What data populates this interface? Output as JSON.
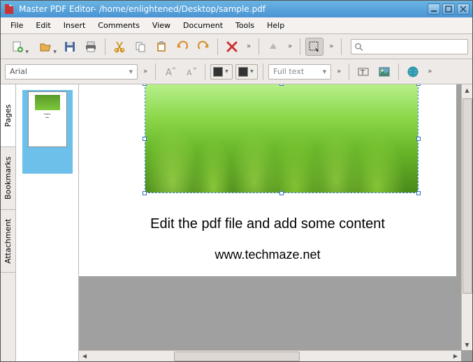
{
  "app": {
    "title": "Master PDF Editor- /home/enlightened/Desktop/sample.pdf",
    "icon": "pdf-app-icon"
  },
  "menu": {
    "items": [
      "File",
      "Edit",
      "Insert",
      "Comments",
      "View",
      "Document",
      "Tools",
      "Help"
    ]
  },
  "toolbar1": {
    "items": [
      {
        "name": "new-doc",
        "drop": true
      },
      {
        "name": "open-doc",
        "drop": true
      },
      {
        "name": "save-doc"
      },
      {
        "name": "print-doc"
      },
      {
        "name": "cut"
      },
      {
        "name": "copy"
      },
      {
        "name": "paste"
      },
      {
        "name": "undo"
      },
      {
        "name": "redo"
      },
      {
        "name": "delete"
      },
      {
        "name": "nav-up"
      },
      {
        "name": "select-tool",
        "active": true
      }
    ],
    "search_placeholder": ""
  },
  "toolbar2": {
    "font": "Arial",
    "fulltext_label": "Full text",
    "colors": {
      "fill": "#333333",
      "stroke": "#333333"
    }
  },
  "sidebar": {
    "tabs": [
      {
        "label": "Pages",
        "active": true
      },
      {
        "label": "Bookmarks",
        "active": false
      },
      {
        "label": "Attachment",
        "active": false
      }
    ]
  },
  "document": {
    "lines": [
      "Edit the pdf file and add some content",
      "www.techmaze.net"
    ],
    "selected_image": "grass-photo"
  }
}
